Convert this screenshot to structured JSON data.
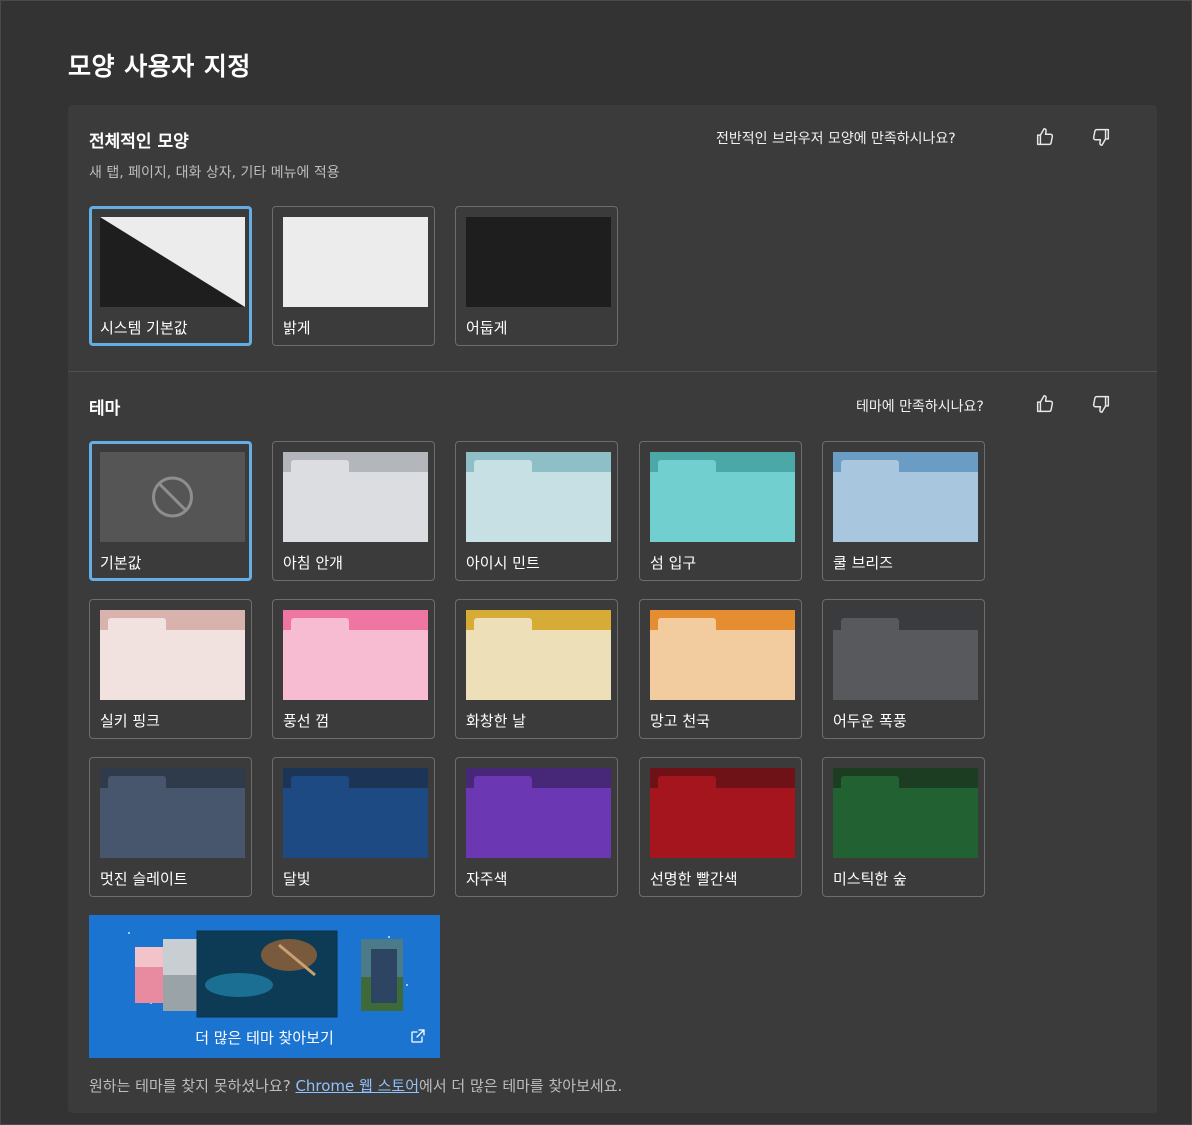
{
  "page": {
    "title": "모양 사용자 지정"
  },
  "overall": {
    "title": "전체적인 모양",
    "subtitle": "새 탭, 페이지, 대화 상자, 기타 메뉴에 적용",
    "feedback_question": "전반적인 브라우저 모양에 만족하시나요?",
    "options": [
      {
        "label": "시스템 기본값",
        "selected": true
      },
      {
        "label": "밝게",
        "selected": false
      },
      {
        "label": "어둡게",
        "selected": false
      }
    ]
  },
  "themes": {
    "title": "테마",
    "feedback_question": "테마에 만족하시나요?",
    "items": [
      {
        "label": "기본값",
        "selected": true,
        "icon": "block-icon"
      },
      {
        "label": "아침 안개",
        "bar": "#b3b6ba",
        "body": "#dcdde0",
        "tab": "#dcdde0"
      },
      {
        "label": "아이시 민트",
        "bar": "#8fbfc6",
        "body": "#c6e0e4",
        "tab": "#c6e0e4"
      },
      {
        "label": "섬 입구",
        "bar": "#4ca7a7",
        "body": "#72cfcf",
        "tab": "#72cfcf"
      },
      {
        "label": "쿨 브리즈",
        "bar": "#6b9cc3",
        "body": "#a8c6de",
        "tab": "#a8c6de"
      },
      {
        "label": "실키 핑크",
        "bar": "#d8b3ad",
        "body": "#f1e2df",
        "tab": "#f1e2df"
      },
      {
        "label": "풍선 껌",
        "bar": "#ef76a2",
        "body": "#f8bcd2",
        "tab": "#f8bcd2"
      },
      {
        "label": "화창한 날",
        "bar": "#d7ac36",
        "body": "#ede0b8",
        "tab": "#ede0b8"
      },
      {
        "label": "망고 천국",
        "bar": "#e58e31",
        "body": "#f2cb9f",
        "tab": "#f2cb9f"
      },
      {
        "label": "어두운 폭풍",
        "bar": "#3a3b3e",
        "body": "#58595c",
        "tab": "#58595c"
      },
      {
        "label": "멋진 슬레이트",
        "bar": "#2f3a4a",
        "body": "#47566d",
        "tab": "#47566d"
      },
      {
        "label": "달빛",
        "bar": "#1c3456",
        "body": "#1d4a82",
        "tab": "#1d4a82"
      },
      {
        "label": "자주색",
        "bar": "#472778",
        "body": "#6b37b2",
        "tab": "#6b37b2"
      },
      {
        "label": "선명한 빨간색",
        "bar": "#6e1217",
        "body": "#a4151d",
        "tab": "#a4151d"
      },
      {
        "label": "미스틱한 숲",
        "bar": "#1c3d22",
        "body": "#226131",
        "tab": "#226131"
      }
    ],
    "more_label": "더 많은 테마 찾아보기",
    "footer_prefix": "원하는 테마를 찾지 못하셨나요? ",
    "footer_link": "Chrome 웹 스토어",
    "footer_suffix": "에서 더 많은 테마를 찾아보세요."
  }
}
